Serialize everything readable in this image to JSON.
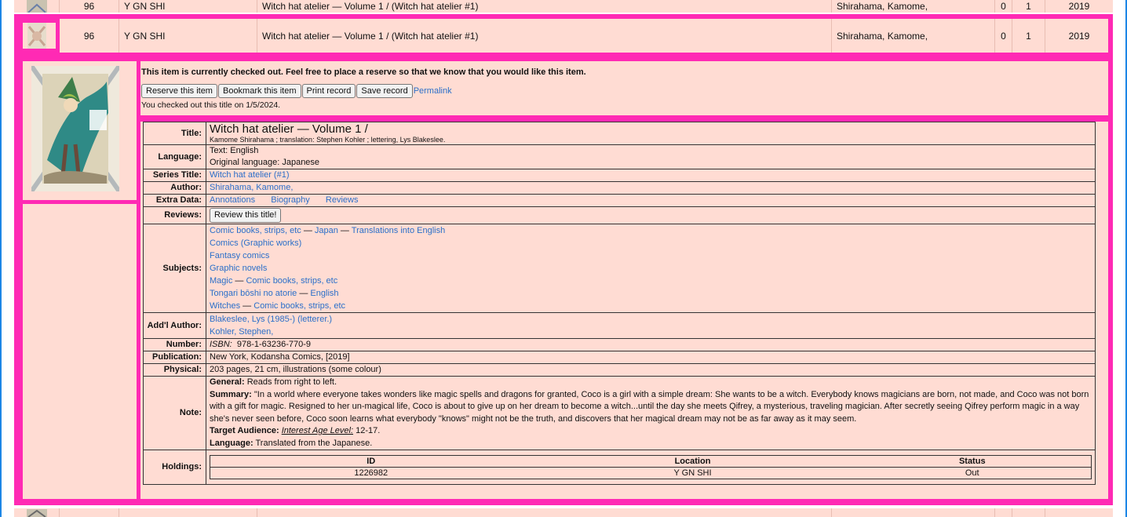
{
  "rows": {
    "prev": {
      "num": "96",
      "call": "Y GN SHI",
      "title": "Witch hat atelier — Volume 1 / (Witch hat atelier #1)",
      "author": "Shirahama, Kamome,",
      "c1": "0",
      "c2": "1",
      "year": "2019"
    },
    "current": {
      "num": "96",
      "call": "Y GN SHI",
      "title": "Witch hat atelier — Volume 1 / (Witch hat atelier #1)",
      "author": "Shirahama, Kamome,",
      "c1": "0",
      "c2": "1",
      "year": "2019"
    }
  },
  "status": {
    "message": "This item is currently checked out. Feel free to place a reserve so that we know that you would like this item.",
    "buttons": {
      "reserve": "Reserve this item",
      "bookmark": "Bookmark this item",
      "print": "Print record",
      "save": "Save record"
    },
    "permalink": "Permalink",
    "checked_out": "You checked out this title on 1/5/2024."
  },
  "record": {
    "labels": {
      "title": "Title:",
      "language": "Language:",
      "series": "Series Title:",
      "author": "Author:",
      "extra": "Extra Data:",
      "reviews": "Reviews:",
      "subjects": "Subjects:",
      "addl": "Add'l Author:",
      "number": "Number:",
      "publication": "Publication:",
      "physical": "Physical:",
      "note": "Note:",
      "holdings": "Holdings:"
    },
    "title": "Witch hat atelier — Volume 1 /",
    "responsibility": "Kamome Shirahama ; translation: Stephen Kohler ; lettering, Lys Blakeslee.",
    "language_text": "Text: English",
    "language_original": "Original language: Japanese",
    "series": "Witch hat atelier (#1)",
    "author": "Shirahama, Kamome,",
    "extra": {
      "annotations": "Annotations",
      "biography": "Biography",
      "reviews": "Reviews"
    },
    "review_button": "Review this title!",
    "subjects": [
      {
        "parts": [
          "Comic books, strips, etc",
          "Japan",
          "Translations into English"
        ],
        "links": [
          true,
          true,
          true
        ]
      },
      {
        "parts": [
          "Comics (Graphic works)"
        ],
        "links": [
          true
        ]
      },
      {
        "parts": [
          "Fantasy comics"
        ],
        "links": [
          true
        ]
      },
      {
        "parts": [
          "Graphic novels"
        ],
        "links": [
          true
        ]
      },
      {
        "parts": [
          "Magic",
          "Comic books, strips, etc"
        ],
        "links": [
          true,
          true
        ]
      },
      {
        "parts": [
          "Tongari bōshi no atorie",
          "English"
        ],
        "links": [
          true,
          true
        ]
      },
      {
        "parts": [
          "Witches",
          "Comic books, strips, etc"
        ],
        "links": [
          true,
          true
        ]
      }
    ],
    "addl_authors": [
      "Blakeslee, Lys (1985-) (letterer.)",
      "Kohler, Stephen,"
    ],
    "isbn_label": "ISBN:",
    "isbn": "978-1-63236-770-9",
    "publication": "New York, Kodansha Comics, [2019]",
    "physical": "203 pages, 21 cm, illustrations (some colour)",
    "note": {
      "general_label": "General:",
      "general": "Reads from right to left.",
      "summary_label": "Summary:",
      "summary": "\"In a world where everyone takes wonders like magic spells and dragons for granted, Coco is a girl with a simple dream: She wants to be a witch. Everybody knows magicians are born, not made, and Coco was not born with a gift for magic. Resigned to her un-magical life, Coco is about to give up on her dream to become a witch...until the day she meets Qifrey, a mysterious, traveling magician. After secretly seeing Qifrey perform magic in a way she's never seen before, Coco soon learns what everybody \"knows\" might not be the truth, and discovers that her magical dream may not be as far away as it may seem.",
      "audience_label": "Target Audience:",
      "audience_level_label": "Interest Age Level:",
      "audience_value": "12-17.",
      "language_label": "Language:",
      "language": "Translated from the Japanese."
    },
    "holdings": {
      "headers": [
        "ID",
        "Location",
        "Status"
      ],
      "rows": [
        [
          "1226982",
          "Y GN SHI",
          "Out"
        ]
      ]
    }
  },
  "colors": {
    "row_bg": "#ffdcd3",
    "highlight": "#ff2ab4",
    "link": "#2a6fc9",
    "edge": "#1c86e6"
  }
}
